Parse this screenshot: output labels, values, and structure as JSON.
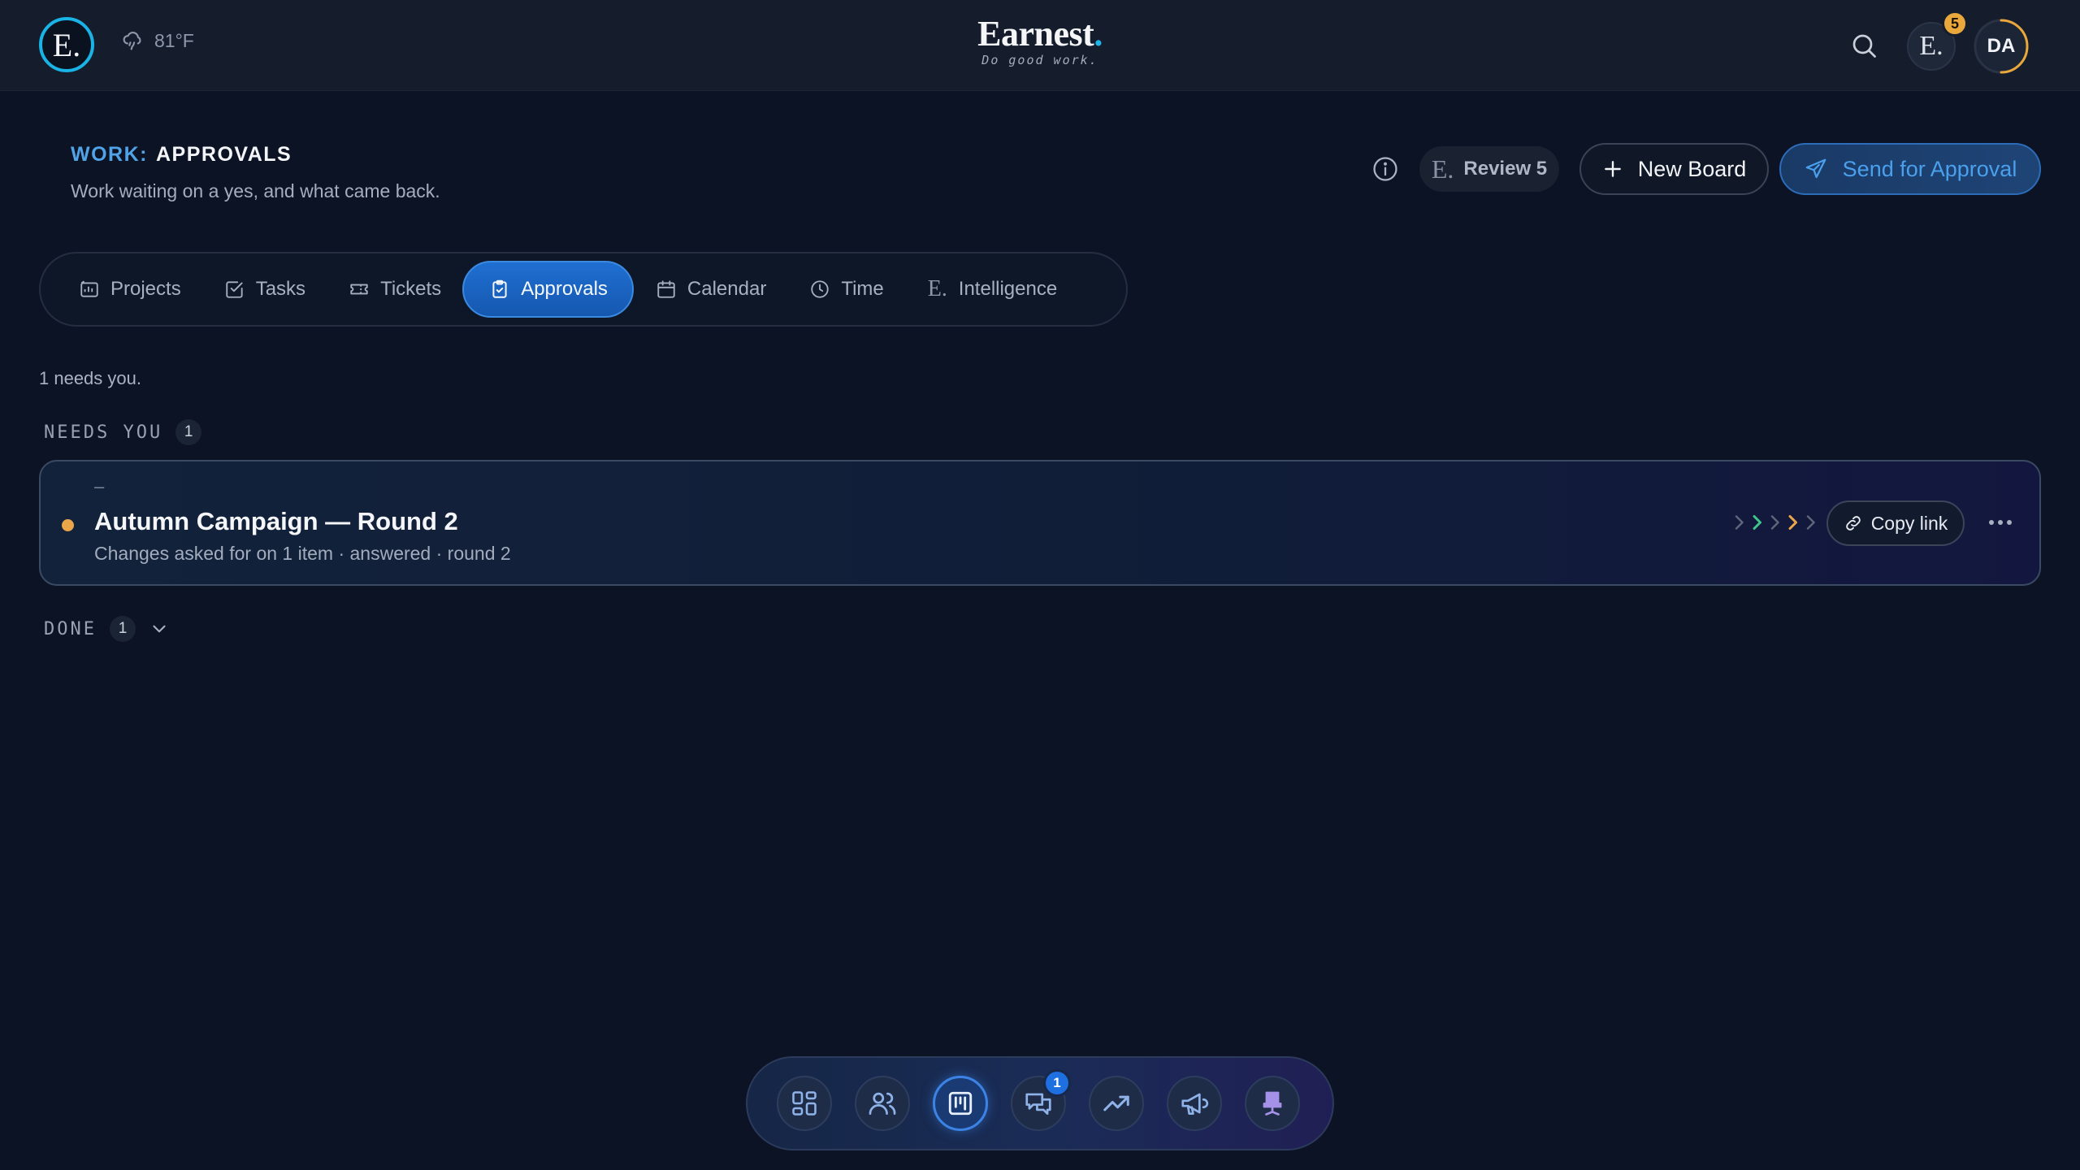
{
  "topbar": {
    "logo_letter": "E.",
    "weather": "81°F",
    "brand_name": "Earnest",
    "brand_dot": ".",
    "brand_tagline": "Do good work.",
    "notif_letter": "E.",
    "notif_count": "5",
    "user_initials": "DA"
  },
  "header": {
    "crumb": "WORK:",
    "title": "APPROVALS",
    "subtitle": "Work waiting on a yes, and what came back.",
    "review_letter": "E.",
    "review_label": "Review 5",
    "new_board_label": "New Board",
    "send_label": "Send for Approval"
  },
  "tabs": [
    {
      "label": "Projects",
      "icon": "projects-icon"
    },
    {
      "label": "Tasks",
      "icon": "check-square-icon"
    },
    {
      "label": "Tickets",
      "icon": "ticket-icon"
    },
    {
      "label": "Approvals",
      "icon": "clipboard-check-icon",
      "active": true
    },
    {
      "label": "Calendar",
      "icon": "calendar-icon"
    },
    {
      "label": "Time",
      "icon": "clock-icon"
    },
    {
      "label": "Intelligence",
      "icon": "e-icon"
    }
  ],
  "content": {
    "needs_note": "1 needs you.",
    "needs_heading": "NEEDS YOU",
    "needs_count": "1",
    "done_heading": "DONE",
    "done_count": "1"
  },
  "card": {
    "dash": "–",
    "title": "Autumn Campaign — Round 2",
    "meta": "Changes asked for on 1 item · answered · round 2",
    "copy_label": "Copy link",
    "status_color": "#eba64a"
  },
  "dock": {
    "items": [
      "dashboard-icon",
      "people-icon",
      "board-icon",
      "chat-icon",
      "trending-icon",
      "megaphone-icon",
      "chair-icon"
    ],
    "chat_badge": "1"
  },
  "colors": {
    "accent": "#1f6fd1",
    "brand_cyan": "#1ab3e6",
    "warning": "#eba64a"
  }
}
